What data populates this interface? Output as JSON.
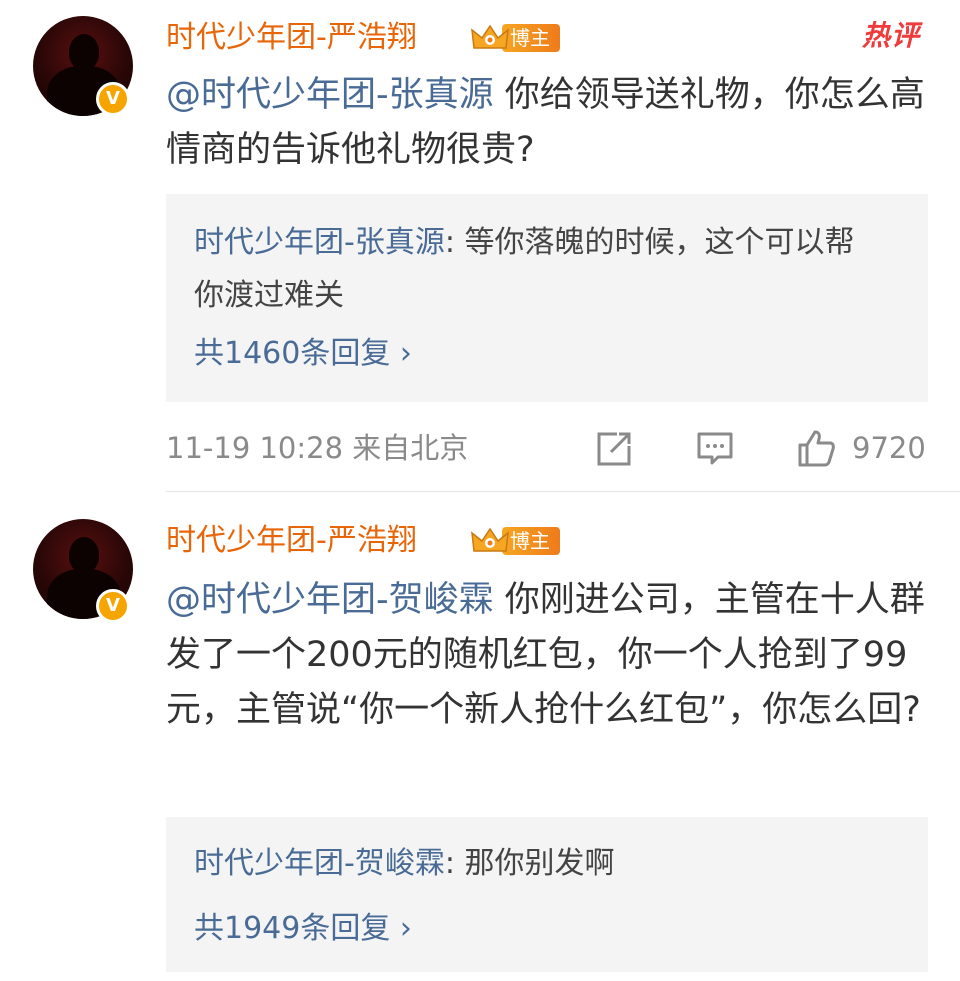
{
  "comments": [
    {
      "username": "时代少年团-严浩翔",
      "badge": "博主",
      "hot_tag": "热评",
      "mention": "@时代少年团-张真源",
      "text": " 你给领导送礼物，你怎么高情商的告诉他礼物很贵?",
      "reply": {
        "user": "时代少年团-张真源",
        "sep": ": ",
        "text": "等你落魄的时候，这个可以帮你渡过难关"
      },
      "reply_count": "共1460条回复 ›",
      "meta": "11-19 10:28  来自北京",
      "likes": "9720"
    },
    {
      "username": "时代少年团-严浩翔",
      "badge": "博主",
      "mention": "@时代少年团-贺峻霖",
      "text": " 你刚进公司，主管在十人群发了一个200元的随机红包，你一个人抢到了99元，主管说“你一个新人抢什么红包”，你怎么回?",
      "reply": {
        "user": "时代少年团-贺峻霖",
        "sep": ": ",
        "text": "那你别发啊"
      },
      "reply_count": "共1949条回复 ›"
    }
  ],
  "icons": [
    "verified-v-icon",
    "crown-icon",
    "share-icon",
    "comment-icon",
    "like-icon"
  ],
  "colors": {
    "username": "#e8660a",
    "link": "#496b95",
    "hot": "#ee3b3b",
    "badge": "#f5a400"
  }
}
